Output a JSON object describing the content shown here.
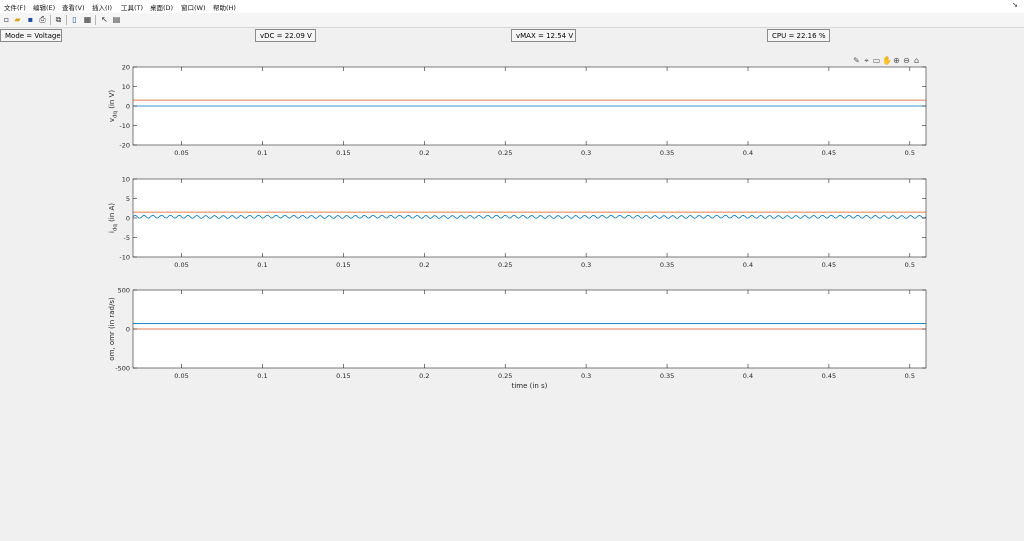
{
  "menu": [
    "文件(F)",
    "编辑(E)",
    "查看(V)",
    "插入(I)",
    "工具(T)",
    "桌面(D)",
    "窗口(W)",
    "帮助(H)"
  ],
  "toolbar_icons": [
    "new-file-icon",
    "open-folder-icon",
    "save-icon",
    "print-icon",
    "zoom-figure-icon",
    "dock-icon",
    "property-editor-icon",
    "pointer-icon",
    "data-cursor-icon"
  ],
  "axes_toolbar_icons": [
    "brush-icon",
    "data-tip-icon",
    "restore-view-icon",
    "pan-icon",
    "zoom-in-icon",
    "zoom-out-icon",
    "home-icon"
  ],
  "status": {
    "mode": "Mode = Voltage",
    "vdc": "vDC = 22.09 V",
    "vmax": "vMAX = 12.54 V",
    "cpu": "CPU = 22.16 %"
  },
  "colors": {
    "blue": "#0072bd",
    "orange": "#d95319"
  },
  "chart_data": [
    {
      "type": "line",
      "ylabel": "v_dq (in V)",
      "ylim": [
        -20,
        20
      ],
      "yticks": [
        -20,
        -10,
        0,
        10,
        20
      ],
      "xlim": [
        0.02,
        0.51
      ],
      "xticks": [
        0.05,
        0.1,
        0.15,
        0.2,
        0.25,
        0.3,
        0.35,
        0.4,
        0.45,
        0.5
      ],
      "xticklabels": [
        "0.05",
        "0.1",
        "0.15",
        "0.2",
        "0.25",
        "0.3",
        "0.35",
        "0.4",
        "0.45",
        "0.5"
      ],
      "grid": false,
      "series": [
        {
          "color": "#0072bd",
          "x": [
            0.02,
            0.51
          ],
          "y": [
            0,
            0
          ]
        },
        {
          "color": "#d95319",
          "x": [
            0.02,
            0.51
          ],
          "y": [
            3,
            3
          ]
        }
      ]
    },
    {
      "type": "line",
      "ylabel": "i_dq (in A)",
      "ylim": [
        -10,
        10
      ],
      "yticks": [
        -10,
        -5,
        0,
        5,
        10
      ],
      "xlim": [
        0.02,
        0.51
      ],
      "xticks": [
        0.05,
        0.1,
        0.15,
        0.2,
        0.25,
        0.3,
        0.35,
        0.4,
        0.45,
        0.5
      ],
      "xticklabels": [
        "0.05",
        "0.1",
        "0.15",
        "0.2",
        "0.25",
        "0.3",
        "0.35",
        "0.4",
        "0.45",
        "0.5"
      ],
      "grid": false,
      "series": [
        {
          "color": "#0072bd",
          "x_start": 0.02,
          "x_end": 0.51,
          "mean": 0.3,
          "ripple_amplitude": 0.35,
          "ripple_cycles": 90
        },
        {
          "color": "#d95319",
          "x": [
            0.02,
            0.51
          ],
          "y": [
            1.5,
            1.5
          ]
        }
      ]
    },
    {
      "type": "line",
      "ylabel": "om, omr (in rad/s)",
      "xlabel": "time (in s)",
      "ylim": [
        -500,
        500
      ],
      "yticks": [
        -500,
        0,
        500
      ],
      "xlim": [
        0.02,
        0.51
      ],
      "xticks": [
        0.05,
        0.1,
        0.15,
        0.2,
        0.25,
        0.3,
        0.35,
        0.4,
        0.45,
        0.5
      ],
      "xticklabels": [
        "0.05",
        "0.1",
        "0.15",
        "0.2",
        "0.25",
        "0.3",
        "0.35",
        "0.4",
        "0.45",
        "0.5"
      ],
      "grid": false,
      "series": [
        {
          "color": "#0072bd",
          "x": [
            0.02,
            0.51
          ],
          "y": [
            70,
            70
          ]
        },
        {
          "color": "#d95319",
          "x": [
            0.02,
            0.51
          ],
          "y": [
            0,
            0
          ]
        }
      ]
    }
  ]
}
